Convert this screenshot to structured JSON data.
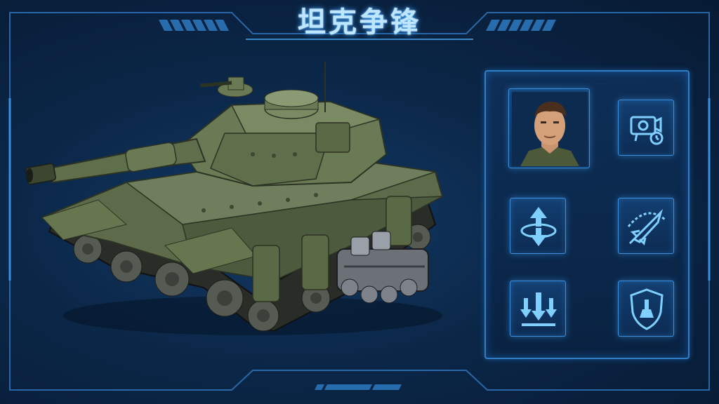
{
  "game": {
    "title": "坦克争锋"
  },
  "tank": {
    "icon": "tank-model"
  },
  "upgrade_panel": {
    "slots": [
      {
        "id": "commander",
        "icon": "commander-portrait-icon"
      },
      {
        "id": "targeting",
        "icon": "targeting-camera-icon"
      },
      {
        "id": "elevate",
        "icon": "elevation-arrows-icon"
      },
      {
        "id": "missile",
        "icon": "missile-rocket-icon"
      },
      {
        "id": "drop",
        "icon": "downward-strike-icon"
      },
      {
        "id": "shield",
        "icon": "shield-defense-icon"
      }
    ]
  },
  "colors": {
    "accent": "#3aa0ff",
    "frame": "#2f7fc8",
    "background": "#0b2748",
    "tank_green": "#5d6b4b"
  }
}
